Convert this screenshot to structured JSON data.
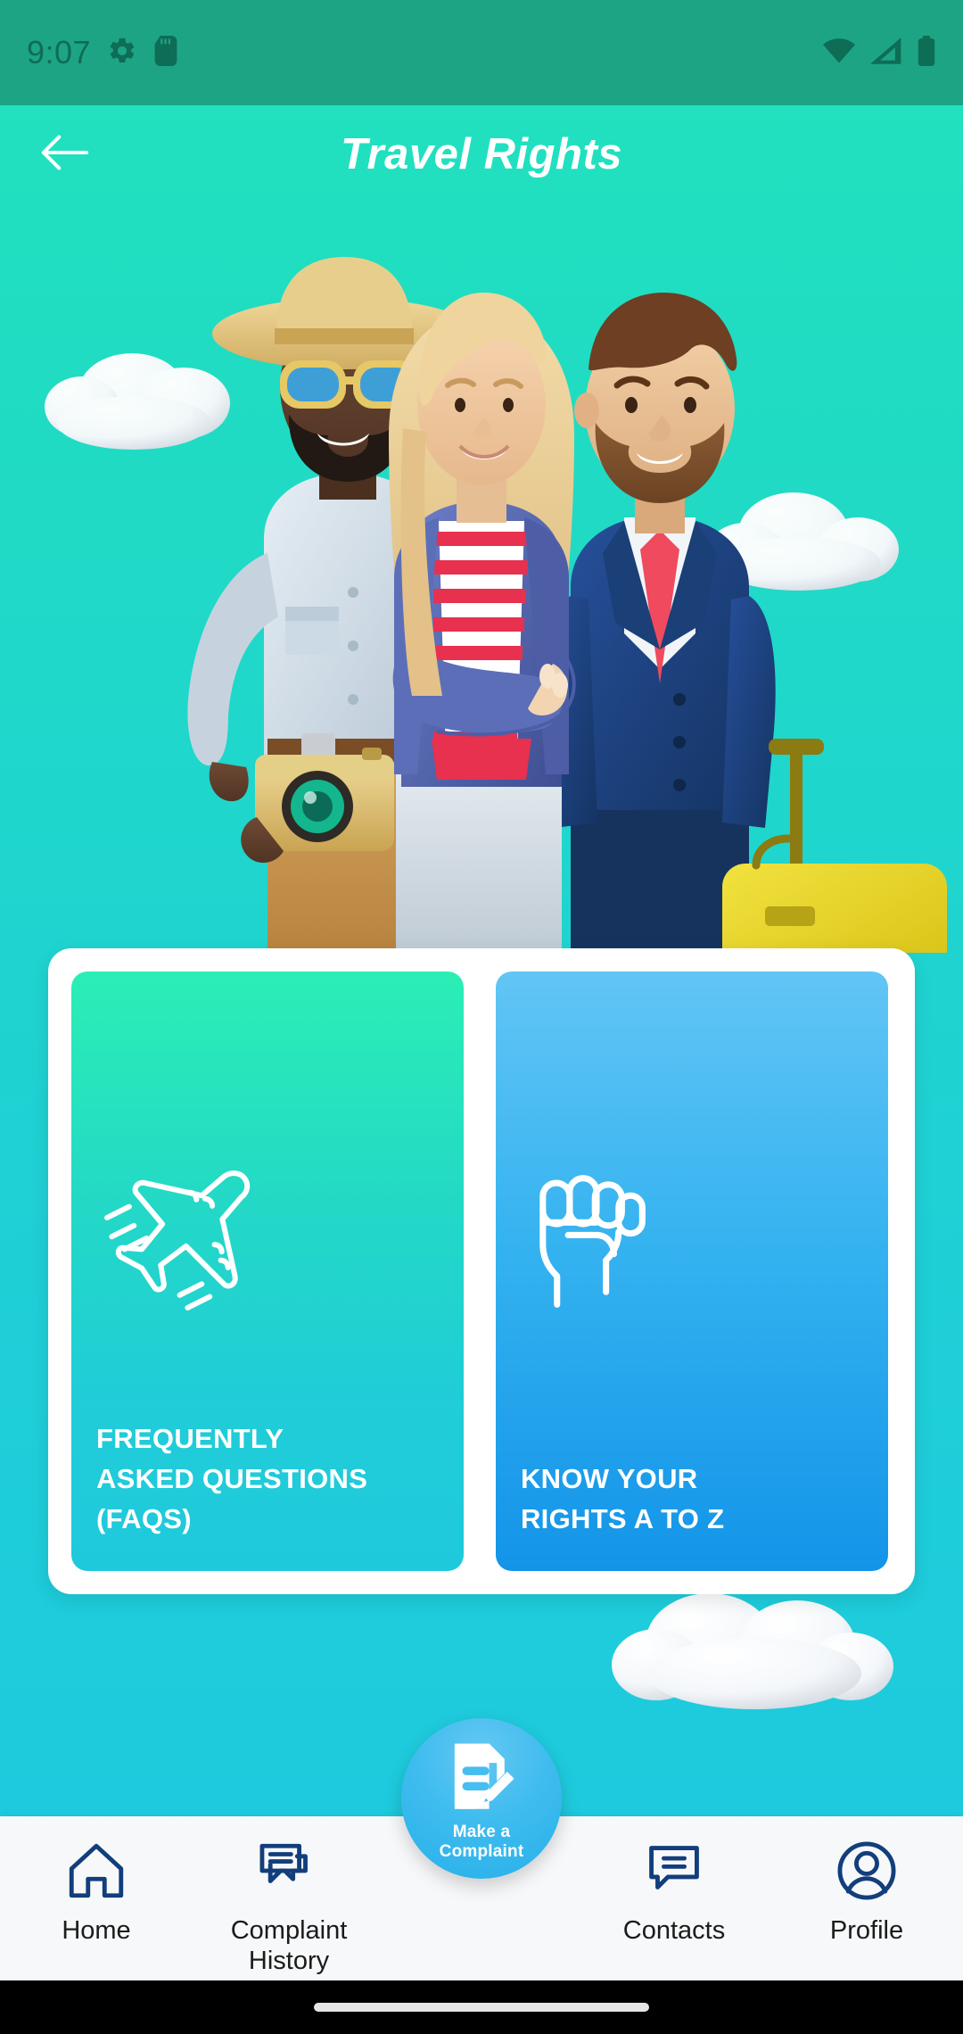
{
  "status_bar": {
    "time": "9:07",
    "left_icons": [
      "gear-icon",
      "sd-card-icon"
    ],
    "right_icons": [
      "wifi-icon",
      "cellular-signal-icon",
      "battery-icon"
    ],
    "background_color": "#1DA484",
    "icon_color": "#0E6D55"
  },
  "header": {
    "title": "Travel Rights",
    "back_icon": "arrow-left-icon",
    "background_color": "#21E3BD",
    "title_color": "#FFFFFF"
  },
  "hero": {
    "description": "3D illustration of three travellers with clouds and a yellow suitcase",
    "characters": [
      "tourist-with-hat-and-camera",
      "woman-in-striped-top",
      "businessman-in-suit"
    ],
    "props": [
      "yellow-suitcase",
      "cloud-left",
      "cloud-right"
    ]
  },
  "cards": [
    {
      "id": "faq",
      "label": "FREQUENTLY\nASKED QUESTIONS\n(FAQS)",
      "icon": "airplane-icon",
      "gradient_from": "#2BEEB5",
      "gradient_to": "#1FC9DD"
    },
    {
      "id": "rights",
      "label": "KNOW YOUR\nRIGHTS A TO Z",
      "icon": "raised-fist-icon",
      "gradient_from": "#62C5F5",
      "gradient_to": "#1394E8"
    }
  ],
  "fab": {
    "label": "Make a\nComplaint",
    "icon": "document-edit-icon",
    "color": "#3FBCEF"
  },
  "bottom_nav": {
    "background_color": "#F7F8F9",
    "icon_color": "#123E7C",
    "items": [
      {
        "label": "Home",
        "icon": "home-icon"
      },
      {
        "label": "Complaint\nHistory",
        "icon": "chat-bubbles-icon"
      },
      {
        "label": "Contacts",
        "icon": "contact-bubble-icon"
      },
      {
        "label": "Profile",
        "icon": "user-circle-icon"
      }
    ]
  },
  "gesture_bar": {
    "visible": true
  }
}
